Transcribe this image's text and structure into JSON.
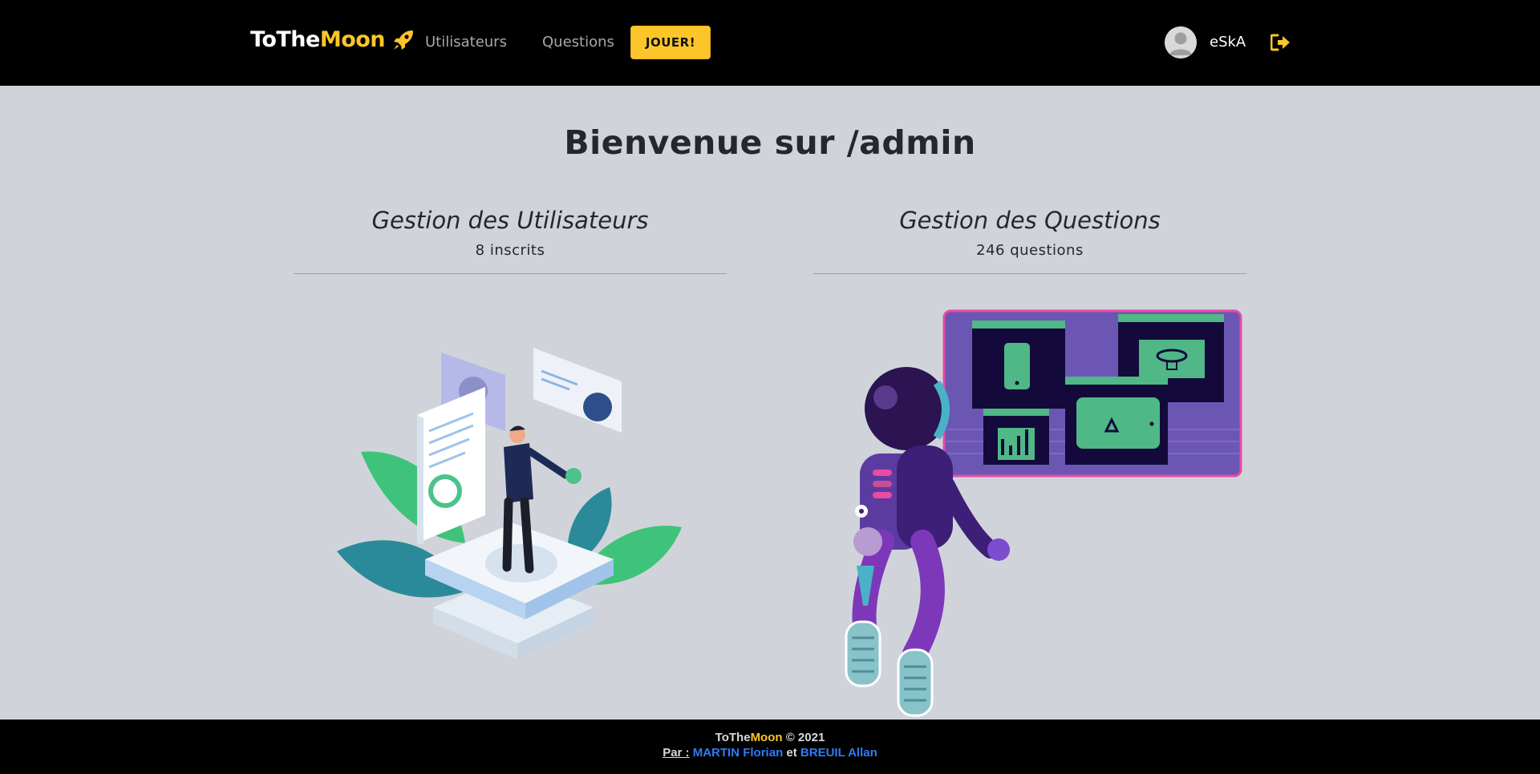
{
  "navbar": {
    "brand": {
      "part1": "ToThe",
      "part2": "Moon"
    },
    "links": {
      "users": "Utilisateurs",
      "questions": "Questions"
    },
    "play_label": "JOUER!",
    "username": "eSkA",
    "icons": {
      "brand": "rocket-icon",
      "avatar": "avatar-icon",
      "logout": "logout-icon"
    }
  },
  "main": {
    "title": "Bienvenue sur /admin",
    "users_section": {
      "title": "Gestion des Utilisateurs",
      "count": "8 inscrits"
    },
    "questions_section": {
      "title": "Gestion des Questions",
      "count": "246 questions"
    }
  },
  "footer": {
    "brand_part1": "ToThe",
    "brand_part2": "Moon",
    "copyright": " © 2021",
    "by_label": "Par :",
    "author1": "MARTIN Florian",
    "and": " et ",
    "author2": "BREUIL Allan"
  },
  "colors": {
    "accent": "#fcc52a",
    "navbar_bg": "#000000",
    "page_bg": "#d0d4da",
    "author_link": "#2e7cf6"
  }
}
